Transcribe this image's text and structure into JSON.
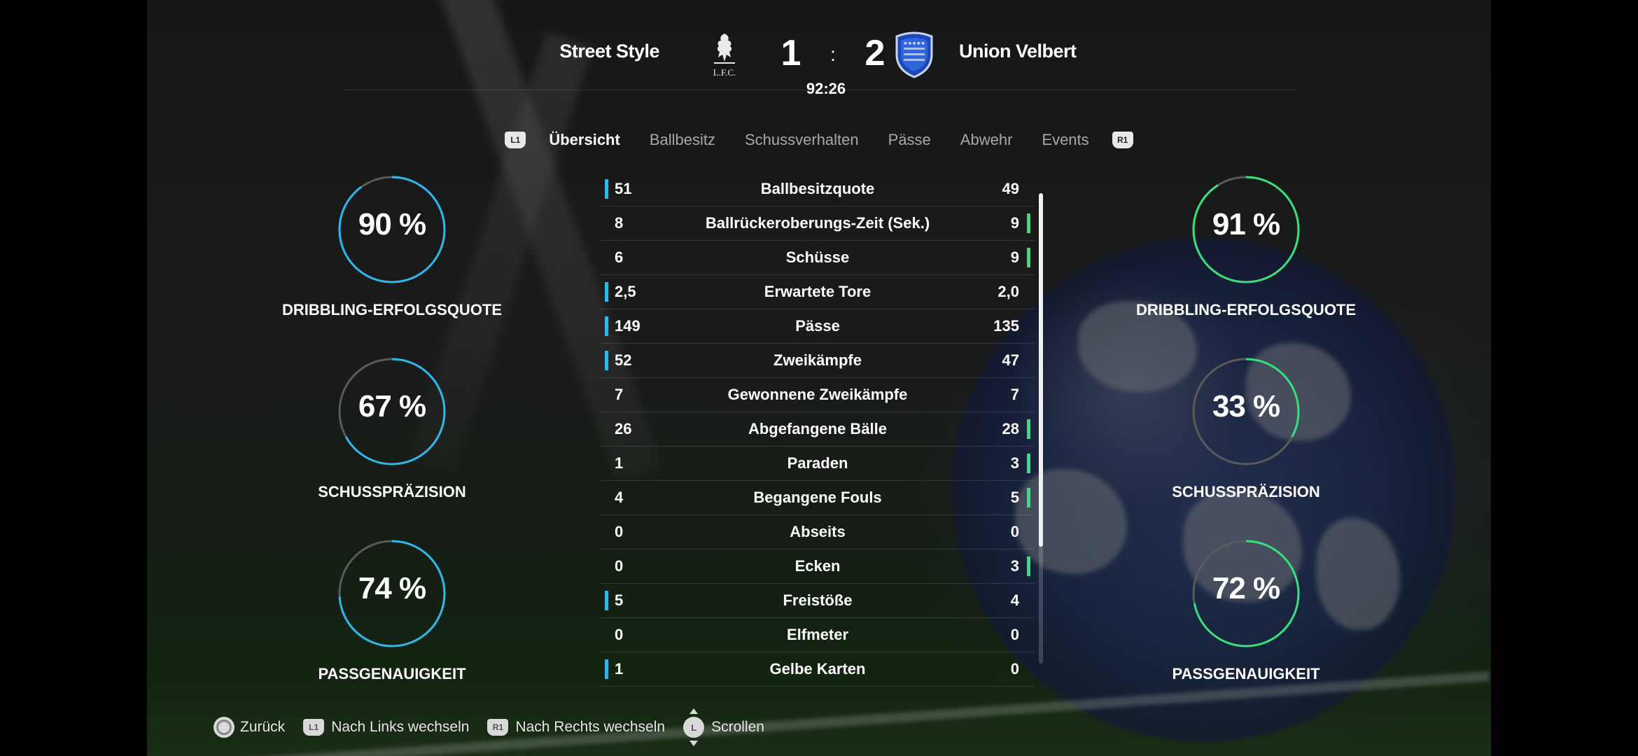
{
  "match": {
    "home_team": "Street Style",
    "away_team": "Union Velbert",
    "home_score": "1",
    "away_score": "2",
    "separator": ":",
    "clock": "92:26",
    "home_crest_text": "L.F.C."
  },
  "colors": {
    "home_accent": "#2fb7ec",
    "away_accent": "#37e07a",
    "ring_track": "#5a5a5a"
  },
  "tabs": {
    "left_button": "L1",
    "right_button": "R1",
    "items": [
      "Übersicht",
      "Ballbesitz",
      "Schussverhalten",
      "Pässe",
      "Abwehr",
      "Events"
    ],
    "active_index": 0
  },
  "home_rings": [
    {
      "value": "90 %",
      "fraction": 0.9,
      "label": "DRIBBLING-ERFOLGSQUOTE"
    },
    {
      "value": "67 %",
      "fraction": 0.67,
      "label": "SCHUSSPRÄZISION"
    },
    {
      "value": "74 %",
      "fraction": 0.74,
      "label": "PASSGENAUIGKEIT"
    }
  ],
  "away_rings": [
    {
      "value": "91 %",
      "fraction": 0.91,
      "label": "DRIBBLING-ERFOLGSQUOTE"
    },
    {
      "value": "33 %",
      "fraction": 0.33,
      "label": "SCHUSSPRÄZISION"
    },
    {
      "value": "72 %",
      "fraction": 0.72,
      "label": "PASSGENAUIGKEIT"
    }
  ],
  "stats": [
    {
      "home": "51",
      "label": "Ballbesitzquote",
      "away": "49",
      "leader": "home"
    },
    {
      "home": "8",
      "label": "Ballrückeroberungs-Zeit (Sek.)",
      "away": "9",
      "leader": "away"
    },
    {
      "home": "6",
      "label": "Schüsse",
      "away": "9",
      "leader": "away"
    },
    {
      "home": "2,5",
      "label": "Erwartete Tore",
      "away": "2,0",
      "leader": "home"
    },
    {
      "home": "149",
      "label": "Pässe",
      "away": "135",
      "leader": "home"
    },
    {
      "home": "52",
      "label": "Zweikämpfe",
      "away": "47",
      "leader": "home"
    },
    {
      "home": "7",
      "label": "Gewonnene Zweikämpfe",
      "away": "7",
      "leader": "none"
    },
    {
      "home": "26",
      "label": "Abgefangene Bälle",
      "away": "28",
      "leader": "away"
    },
    {
      "home": "1",
      "label": "Paraden",
      "away": "3",
      "leader": "away"
    },
    {
      "home": "4",
      "label": "Begangene Fouls",
      "away": "5",
      "leader": "away"
    },
    {
      "home": "0",
      "label": "Abseits",
      "away": "0",
      "leader": "none"
    },
    {
      "home": "0",
      "label": "Ecken",
      "away": "3",
      "leader": "away"
    },
    {
      "home": "5",
      "label": "Freistöße",
      "away": "4",
      "leader": "home"
    },
    {
      "home": "0",
      "label": "Elfmeter",
      "away": "0",
      "leader": "none"
    },
    {
      "home": "1",
      "label": "Gelbe Karten",
      "away": "0",
      "leader": "home"
    }
  ],
  "scroll": {
    "position": 0.0,
    "visible_fraction": 0.75
  },
  "footer": {
    "back_label": "Zurück",
    "left_button": "L1",
    "left_label": "Nach Links wechseln",
    "right_button": "R1",
    "right_label": "Nach Rechts wechseln",
    "stick_button": "L",
    "scroll_label": "Scrollen"
  }
}
